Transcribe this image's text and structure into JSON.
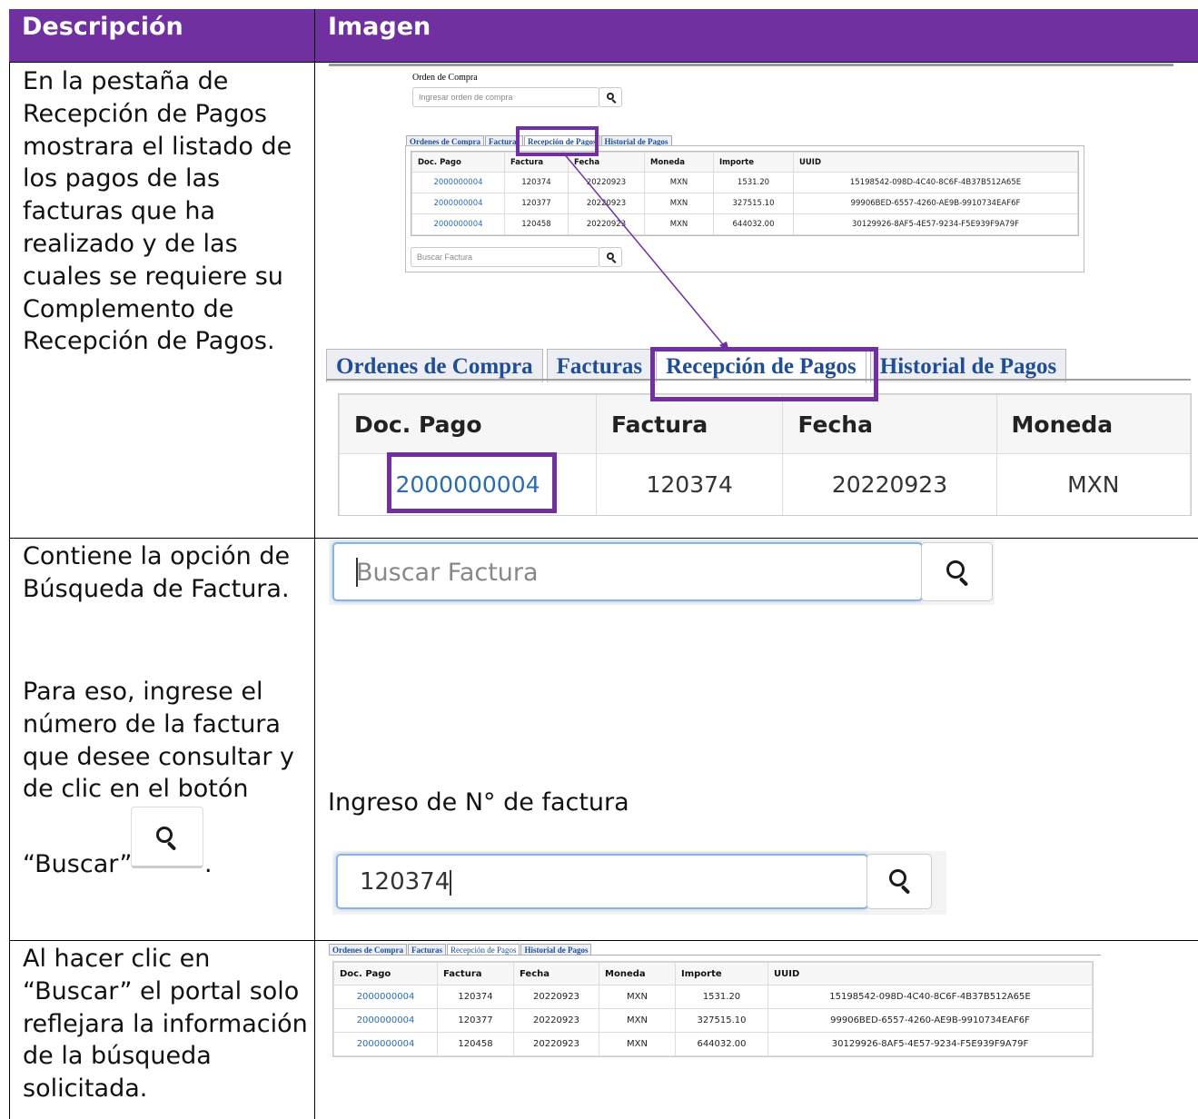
{
  "header": {
    "col1": "Descripción",
    "col2": "Imagen"
  },
  "rows": {
    "r1_desc": [
      "En la pestaña de",
      "Recepción de Pagos",
      "mostrara el listado de",
      "los pagos de las",
      "facturas que ha",
      "realizado y de las",
      "cuales se requiere su",
      "Complemento de",
      "Recepción de Pagos."
    ],
    "r2_desc_a": [
      "Contiene la opción de",
      "Búsqueda de Factura."
    ],
    "r2_desc_b": [
      "Para eso, ingrese el",
      "número de la factura",
      "que desee consultar y",
      "de clic en el botón"
    ],
    "r2_buscar_pre": "“Buscar”",
    "r2_buscar_post": ".",
    "r3_desc": [
      "Al hacer clic en",
      "“Buscar” el portal solo",
      "reflejara la información",
      "de la búsqueda",
      "solicitada."
    ]
  },
  "screen1": {
    "order_label": "Orden de Compra",
    "order_placeholder": "Ingresar orden de compra",
    "tabs": [
      "Ordenes de Compra",
      "Facturas",
      "Recepción de Pagos",
      "Historial de Pagos"
    ],
    "columns": [
      "Doc. Pago",
      "Factura",
      "Fecha",
      "Moneda",
      "Importe",
      "UUID"
    ],
    "rows": [
      [
        "2000000004",
        "120374",
        "20220923",
        "MXN",
        "1531.20",
        "15198542-098D-4C40-8C6F-4B37B512A65E"
      ],
      [
        "2000000004",
        "120377",
        "20220923",
        "MXN",
        "327515.10",
        "99906BED-6557-4260-AE9B-9910734EAF6F"
      ],
      [
        "2000000004",
        "120458",
        "20220923",
        "MXN",
        "644032.00",
        "30129926-8AF5-4E57-9234-F5E939F9A79F"
      ]
    ],
    "search_placeholder": "Buscar Factura"
  },
  "zoom": {
    "tabs": [
      "Ordenes de Compra",
      "Facturas",
      "Recepción de Pagos",
      "Historial de Pagos"
    ],
    "columns": [
      "Doc. Pago",
      "Factura",
      "Fecha",
      "Moneda"
    ],
    "row": [
      "2000000004",
      "120374",
      "20220923",
      "MXN"
    ]
  },
  "search1": {
    "placeholder": "Buscar Factura"
  },
  "caption_ingreso": "Ingreso de N° de factura",
  "search2": {
    "value": "120374"
  },
  "screen3": {
    "tabs": [
      "Ordenes de Compra",
      "Facturas",
      "Recepción de Pagos",
      "Historial de Pagos"
    ],
    "columns": [
      "Doc. Pago",
      "Factura",
      "Fecha",
      "Moneda",
      "Importe",
      "UUID"
    ],
    "rows": [
      [
        "2000000004",
        "120374",
        "20220923",
        "MXN",
        "1531.20",
        "15198542-098D-4C40-8C6F-4B37B512A65E"
      ],
      [
        "2000000004",
        "120377",
        "20220923",
        "MXN",
        "327515.10",
        "99906BED-6557-4260-AE9B-9910734EAF6F"
      ],
      [
        "2000000004",
        "120458",
        "20220923",
        "MXN",
        "644032.00",
        "30129926-8AF5-4E57-9234-F5E939F9A79F"
      ]
    ]
  },
  "colors": {
    "header_bg": "#7030a0",
    "highlight": "#7030a0",
    "link": "#2a6bb5",
    "tab_text": "#1f4e96"
  }
}
